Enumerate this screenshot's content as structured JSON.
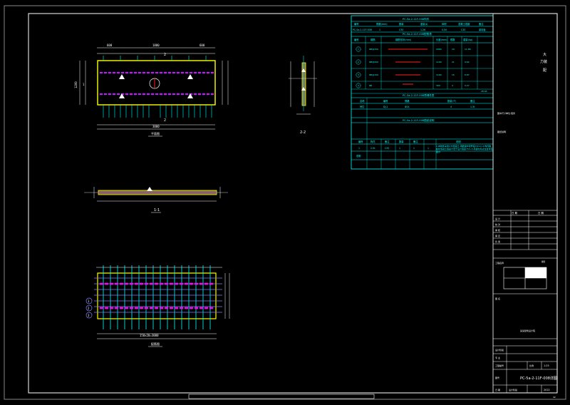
{
  "drawing": {
    "plan_title": "平面图",
    "elevation_title": "立面图",
    "section_11": "1-1",
    "section_22": "2-2",
    "reinforcement_title": "配筋图",
    "dims": {
      "plan_total": "3000",
      "plan_seg_a": "600",
      "plan_seg_b": "1800",
      "plan_seg_c": "600",
      "plan_height": "1200",
      "rebar_total": "3000",
      "rebar_bottom": "150x20=3000"
    },
    "markers": {
      "two": "2",
      "one": "1",
      "circle_labels": [
        "1",
        "2",
        "3"
      ]
    }
  },
  "table": {
    "title1": "PC-5a-2-11F-008构件",
    "header1": [
      "编号",
      "规格(mm)",
      "数量",
      "重量(t)",
      "体积",
      "混凝土强度",
      "备注"
    ],
    "row1": [
      "PC-5a-2-11F-008",
      "1",
      "C35",
      "1.26",
      "0.50",
      "C35",
      "单向板"
    ],
    "title2": "PC-5a-2-11F-008配筋表",
    "header2": [
      "编号",
      "钢筋",
      "钢筋形状(mm)",
      "长度(mm)",
      "根数",
      "重量(kg)"
    ],
    "rebars": [
      {
        "no": "1",
        "spec": "Φ8@150",
        "len": "2960",
        "qty": "10",
        "wt": "11.68"
      },
      {
        "no": "2",
        "spec": "Φ8@200",
        "len": "1160",
        "qty": "21",
        "wt": "9.62"
      },
      {
        "no": "3",
        "spec": "Φ8@150",
        "len": "1160",
        "qty": "15",
        "wt": "6.87"
      },
      {
        "no": "4",
        "spec": "Φ6",
        "len": "300",
        "qty": "4",
        "wt": "0.27"
      }
    ],
    "total": "28.44",
    "title3": "PC-5a-2-11F-008预埋件表",
    "header3": [
      "名称",
      "编号",
      "规格",
      "数量(个)",
      "备注"
    ],
    "row3": [
      "吊钉",
      "DJ-1",
      "Φ14",
      "4",
      "1.3t"
    ],
    "title4": "PC-5a-2-11F-008图纸说明",
    "header4": [
      "编号",
      "构件",
      "备注",
      "数量",
      "备注",
      "说明"
    ],
    "row4": [
      "1",
      "2.5t",
      "C35",
      "1",
      "1",
      "1"
    ],
    "row5": [
      "说明"
    ],
    "notes": "1.本构件采用C35混凝土,钢筋保护层厚度15mm.2.构件脱模时混凝土强度不低于设计强度75%.3.吊装时吊点位置详见图示."
  },
  "side_notes": {
    "note1": "图中尺寸单位:毫米",
    "note2": "图纸说明",
    "vertical_chars": [
      "大",
      "力装",
      "配"
    ]
  },
  "titleblock": {
    "top_left": "日 期",
    "top_right": "日 期",
    "rows": [
      "设 计",
      "校 对",
      "审 核",
      "审 定",
      "负 责"
    ],
    "mid_label": "工程名称",
    "scale_label": "比例",
    "scale_value": "1:25",
    "proj_label": "图号",
    "drawing_no": "PC-5a-2-11F-008详图",
    "rows2": [
      "图 名",
      "设计阶段",
      "专 业",
      "工程编号"
    ],
    "bottom_left": "日 期",
    "bottom_mid": "设计阶段",
    "bottom_right": "2022",
    "stamp": "某某建筑设计院",
    "sheet_no": "42",
    "corner_label": "图签"
  },
  "colors": {
    "frame": "#ffffff",
    "cyan": "#00ffff",
    "yellow": "#ffff00",
    "magenta": "#ff00ff",
    "red": "#ff2020",
    "green": "#00ff00",
    "blue": "#3050ff",
    "panel": "#6060a0"
  }
}
